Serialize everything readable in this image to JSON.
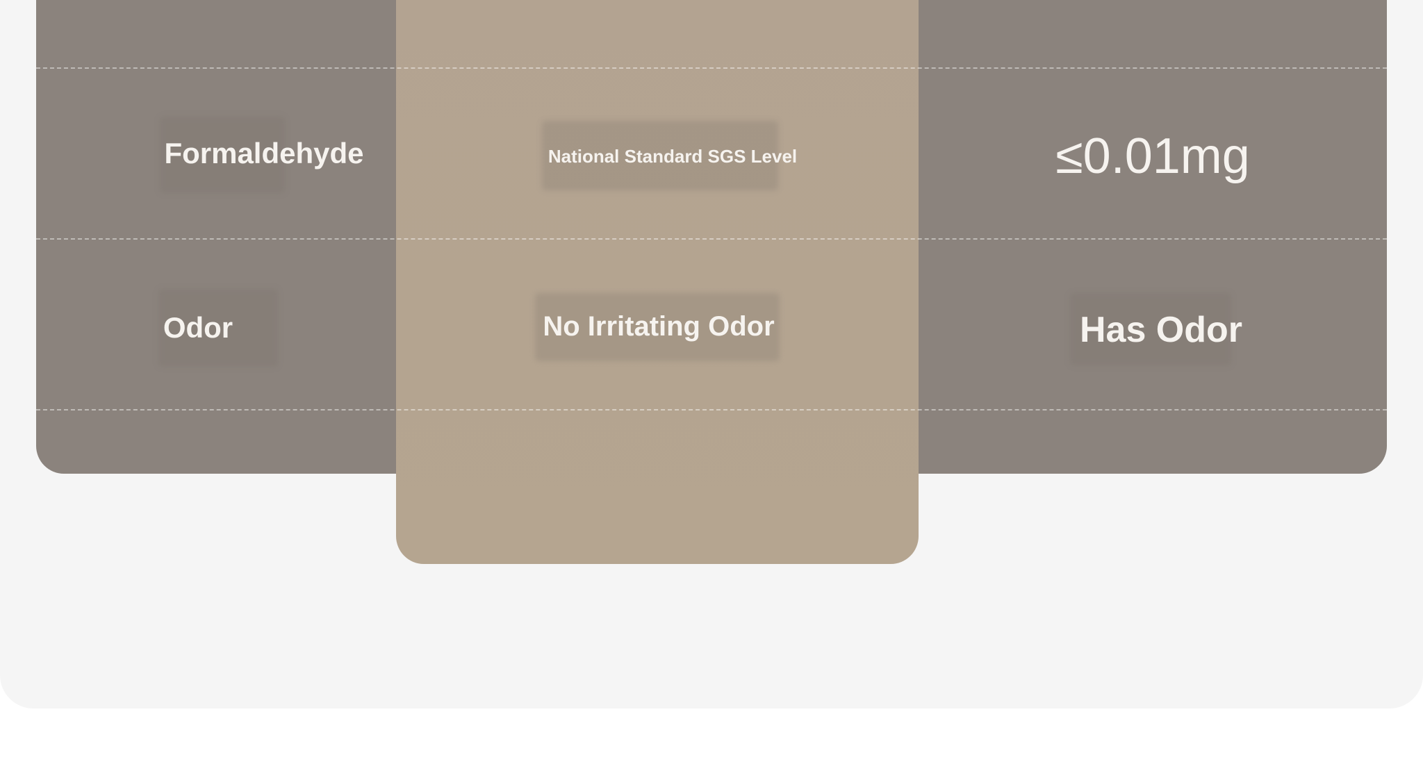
{
  "table": {
    "header_row": {
      "col1": "",
      "col2": "",
      "col3": ""
    },
    "rows": [
      {
        "label": "Formaldehyde",
        "ours": "National Standard SGS Level",
        "others": "≤0.01mg"
      },
      {
        "label": "Odor",
        "ours": "No Irritating Odor",
        "others": "Has Odor"
      }
    ]
  },
  "colors": {
    "page_background": "#f5f5f5",
    "table_background": "#8b837d",
    "highlight_column": "#b4a491",
    "text": "#f6f3ef"
  }
}
